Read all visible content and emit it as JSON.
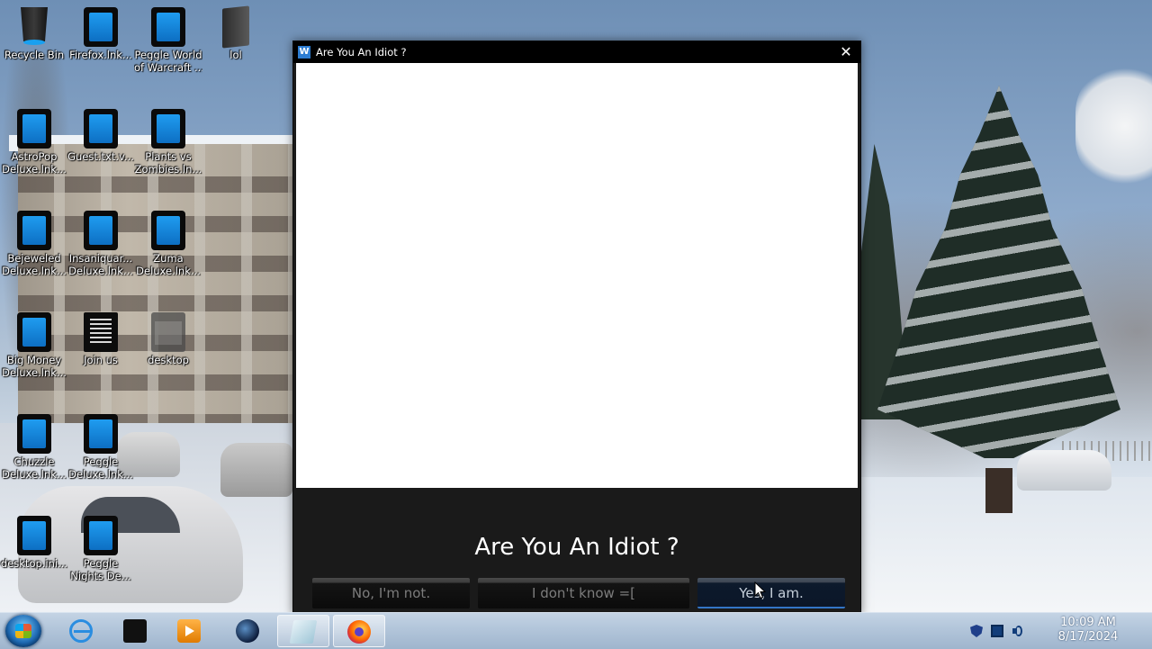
{
  "desktop": {
    "icons": [
      {
        "label": "Recycle Bin",
        "icon": "recycle-bin-icon"
      },
      {
        "label": "Firefox.lnk...",
        "icon": "shortcut-icon"
      },
      {
        "label": "Peggle World",
        "label2": "of Warcraft ...",
        "icon": "shortcut-icon"
      },
      {
        "label": "lol",
        "icon": "file-icon"
      },
      {
        "label": "AstroPop",
        "label2": "Deluxe.lnk...",
        "icon": "shortcut-icon"
      },
      {
        "label": "Guest.txt.v...",
        "icon": "shortcut-icon"
      },
      {
        "label": "Plants vs",
        "label2": "Zombies.ln...",
        "icon": "shortcut-icon"
      },
      {
        "label": "Bejeweled",
        "label2": "Deluxe.lnk...",
        "icon": "shortcut-icon"
      },
      {
        "label": "Insaniquar...",
        "label2": "Deluxe.lnk...",
        "icon": "shortcut-icon"
      },
      {
        "label": "Zuma",
        "label2": "Deluxe.lnk...",
        "icon": "shortcut-icon"
      },
      {
        "label": "Big Money",
        "label2": "Deluxe.lnk...",
        "icon": "shortcut-icon"
      },
      {
        "label": "Join us",
        "icon": "text-document-icon"
      },
      {
        "label": "desktop",
        "icon": "folder-icon"
      },
      {
        "label": "Chuzzle",
        "label2": "Deluxe.lnk...",
        "icon": "shortcut-icon"
      },
      {
        "label": "Peggle",
        "label2": "Deluxe.lnk...",
        "icon": "shortcut-icon"
      },
      {
        "label": "desktop.ini...",
        "icon": "shortcut-icon"
      },
      {
        "label": "Peggle",
        "label2": "Nights De...",
        "icon": "shortcut-icon"
      }
    ]
  },
  "dialog": {
    "title": "Are You An Idiot ?",
    "question": "Are You An Idiot ?",
    "buttons": {
      "no": "No, I'm not.",
      "idk": "I don't know =[",
      "yes": "Yes, I am."
    }
  },
  "taskbar": {
    "pinned": [
      "start-button",
      "internet-explorer-icon",
      "black-app-icon",
      "media-player-icon",
      "globe-icon",
      "notepad-icon",
      "firefox-icon"
    ],
    "clock": {
      "time": "10:09 AM",
      "date": "8/17/2024"
    }
  },
  "colors": {
    "dialog_bg": "#1a1a1a",
    "titlebar": "#000000",
    "accent": "#3375c7"
  }
}
